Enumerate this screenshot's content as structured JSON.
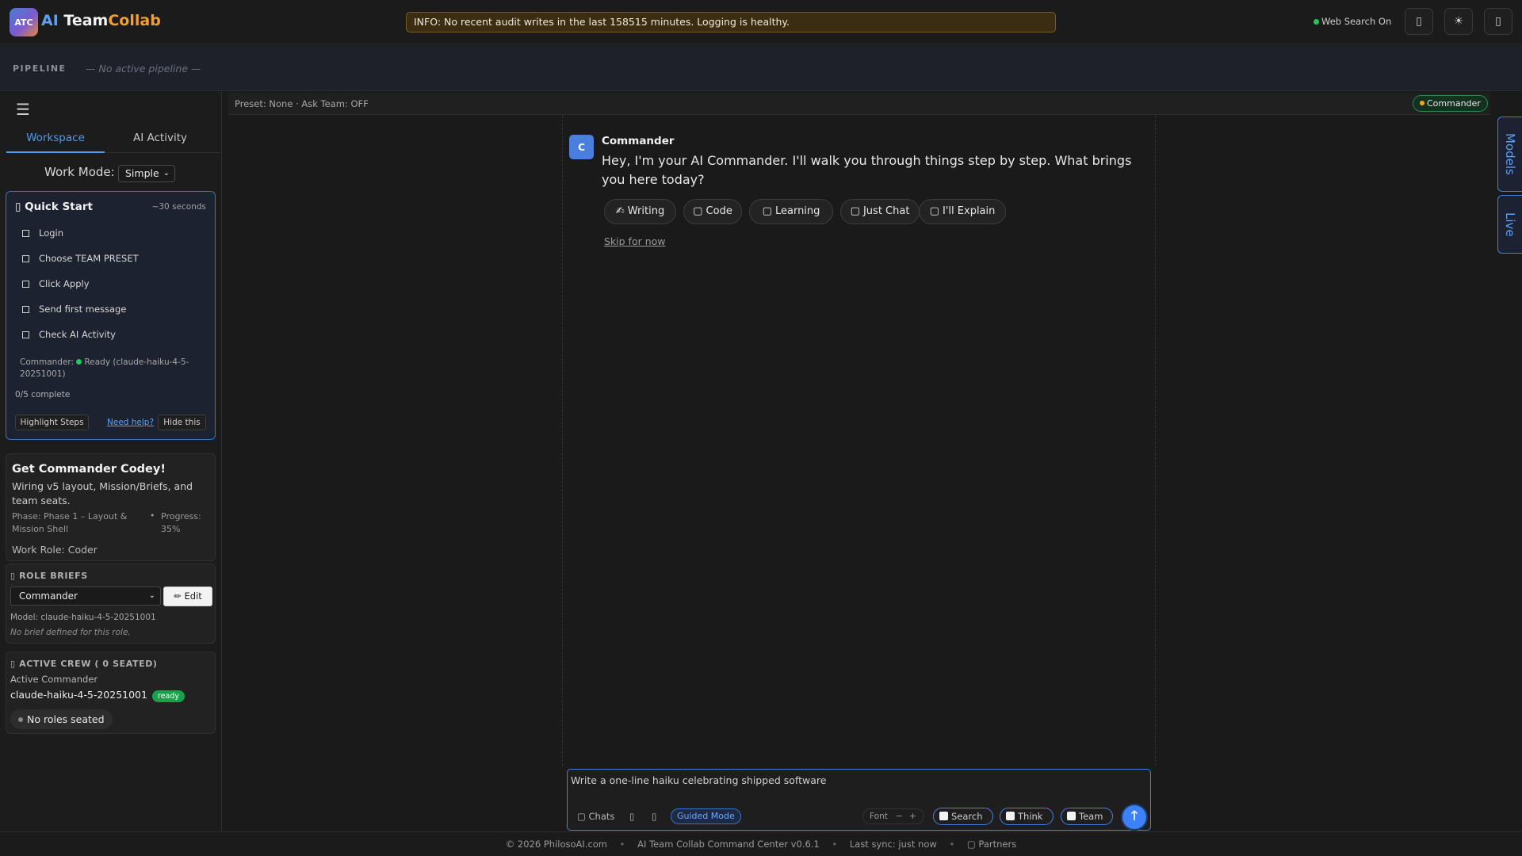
{
  "header": {
    "logo_badge": "ATC",
    "brand_ai": "AI",
    "brand_team": "Team",
    "brand_collab": "Collab",
    "info_banner": "INFO: No recent audit writes in the last 158515 minutes. Logging is healthy.",
    "web_search_status": "Web Search On",
    "icons": [
      "phone-icon",
      "theme-sun-icon",
      "user-icon"
    ],
    "colors": {
      "ai": "#5ea0f5",
      "collab": "#f59e2b",
      "status_ok": "#22c55e"
    }
  },
  "pipeline": {
    "label": "PIPELINE",
    "status": "— No active pipeline —"
  },
  "sidebar": {
    "tabs": [
      {
        "label": "Workspace",
        "active": true
      },
      {
        "label": "AI Activity",
        "active": false
      }
    ],
    "work_mode_label": "Work Mode:",
    "work_mode_value": "Simple",
    "quick_start": {
      "icon": "rocket-icon",
      "title": "Quick Start",
      "time": "~30 seconds",
      "steps": [
        "Login",
        "Choose TEAM PRESET",
        "Click Apply",
        "Send first message",
        "Check AI Activity"
      ],
      "status_label": "Commander:",
      "status_value": "Ready (claude-haiku-4-5-20251001)",
      "progress": "0/5 complete",
      "highlight_button": "Highlight Steps",
      "help_link": "Need help?",
      "hide_button": "Hide this"
    },
    "codey": {
      "title": "Get Commander Codey!",
      "description": "Wiring v5 layout, Mission/Briefs, and team seats.",
      "phase": "Phase: Phase 1 – Layout & Mission Shell",
      "bullet": "•",
      "progress": "Progress: 35%",
      "work_role": "Work Role: Coder"
    },
    "role_briefs": {
      "title": "ROLE BRIEFS",
      "selected_role": "Commander",
      "edit_button": "✏ Edit",
      "model": "Model: claude-haiku-4-5-20251001",
      "note": "No brief defined for this role."
    },
    "active_crew": {
      "title": "ACTIVE CREW ( 0 SEATED)",
      "commander_label": "Active Commander",
      "commander_model": "claude-haiku-4-5-20251001",
      "badge": "ready",
      "no_roles": "No roles seated"
    }
  },
  "main": {
    "preset_text": "Preset: None · Ask Team: OFF",
    "commander_chip": "Commander",
    "message": {
      "avatar": "C",
      "author": "Commander",
      "text": "Hey, I'm your AI Commander. I'll walk you through things step by step. What brings you here today?"
    },
    "choices": [
      "✍ Writing",
      "▢ Code",
      "▢ Learning",
      "▢ Just Chat",
      "▢ I'll Explain"
    ],
    "skip": "Skip for now"
  },
  "composer": {
    "input_value": "Write a one-line haiku celebrating shipped software",
    "chats": "▢ Chats",
    "guided_mode": "Guided Mode",
    "font_label": "Font",
    "font_minus": "−",
    "font_plus": "+",
    "toggles": [
      "Search",
      "Think",
      "Team"
    ],
    "send_icon": "🡑"
  },
  "right_rail": {
    "tabs": [
      "Models",
      "Live"
    ]
  },
  "footer": {
    "items": [
      "© 2026 PhilosoAI.com",
      "AI Team Collab Command Center v0.6.1",
      "Last sync: just now",
      "▢ Partners"
    ]
  }
}
